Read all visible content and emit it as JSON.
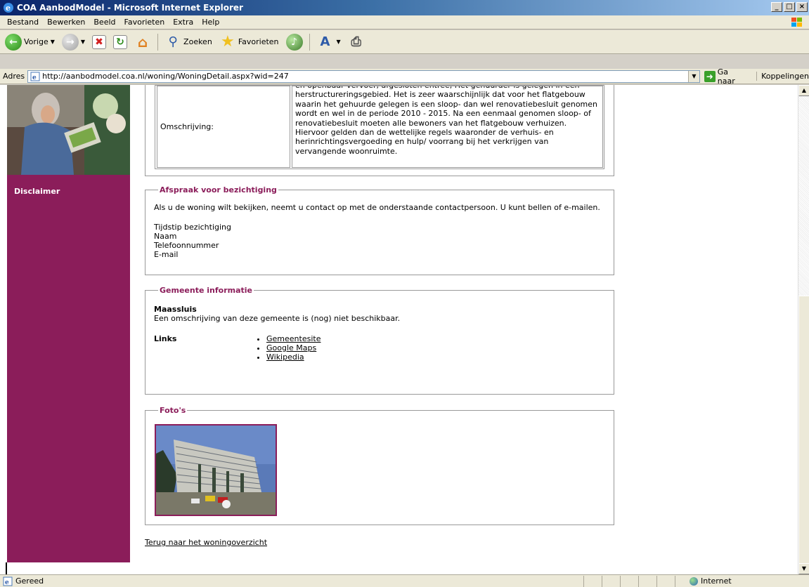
{
  "window": {
    "title": "COA AanbodModel - Microsoft Internet Explorer",
    "btn_min": "_",
    "btn_max": "□",
    "btn_close": "×"
  },
  "menu": {
    "items": [
      "Bestand",
      "Bewerken",
      "Beeld",
      "Favorieten",
      "Extra",
      "Help"
    ]
  },
  "toolbar": {
    "back_label": "Vorige",
    "search_label": "Zoeken",
    "favorites_label": "Favorieten"
  },
  "address": {
    "label": "Adres",
    "url": "http://aanbodmodel.coa.nl/woning/WoningDetail.aspx?wid=247",
    "go_label": "Ga naar",
    "links_label": "Koppelingen"
  },
  "sidebar": {
    "disclaimer": "Disclaimer"
  },
  "description": {
    "label": "Omschrijving:",
    "text": "en openbaar vervoer, afgesloten entree, Het gehuurder is gelegen in een herstructureringsgebied. Het is zeer waarschijnlijk dat voor het flatgebouw waarin het gehuurde gelegen is een sloop- dan wel renovatiebesluit genomen wordt en wel in de periode 2010 - 2015. Na een eenmaal genomen sloop- of renovatiebesluit moeten alle bewoners van het flatgebouw verhuizen. Hiervoor gelden dan de wettelijke regels waaronder de verhuis- en herinrichtingsvergoeding en hulp/ voorrang bij het verkrijgen van vervangende woonruimte."
  },
  "viewing": {
    "legend": "Afspraak voor bezichtiging",
    "intro": "Als u de woning wilt bekijken, neemt u contact op met de onderstaande contactpersoon. U kunt bellen of e-mailen.",
    "fields": [
      "Tijdstip bezichtiging",
      "Naam",
      "Telefoonnummer",
      "E-mail"
    ]
  },
  "municipality": {
    "legend": "Gemeente informatie",
    "name": "Maassluis",
    "description": "Een omschrijving van deze gemeente is (nog) niet beschikbaar.",
    "links_label": "Links",
    "links": [
      "Gemeentesite",
      "Google Maps",
      "Wikipedia"
    ]
  },
  "photos": {
    "legend": "Foto's"
  },
  "back_link": "Terug naar het woningoverzicht",
  "status": {
    "text": "Gereed",
    "zone": "Internet"
  }
}
